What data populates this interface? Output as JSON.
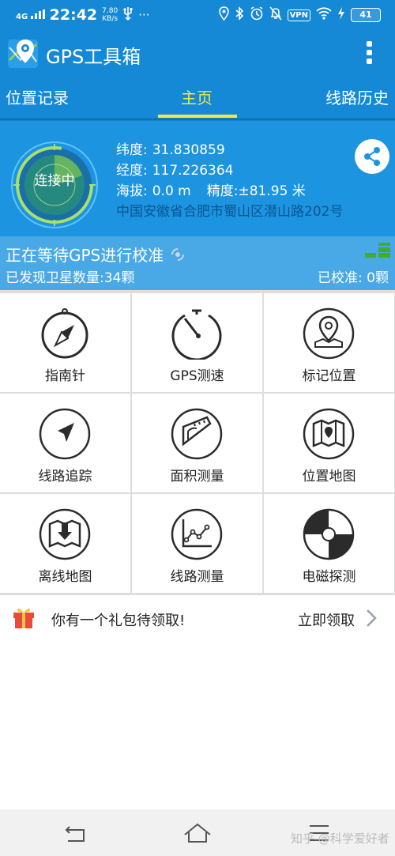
{
  "status_bar": {
    "network": "4G",
    "time": "22:42",
    "speed_value": "7.80",
    "speed_unit": "KB/s",
    "more": "···",
    "vpn": "VPN",
    "battery": "41"
  },
  "app": {
    "title": "GPS工具箱",
    "icons": [
      "gps-logo",
      "more-vertical-icon"
    ]
  },
  "tabs": [
    {
      "label": "位置记录",
      "active": false
    },
    {
      "label": "主页",
      "active": true
    },
    {
      "label": "线路历史",
      "active": false
    }
  ],
  "info": {
    "radar_label": "连接中",
    "latitude_label": "纬度:",
    "latitude": "31.830859",
    "longitude_label": "经度:",
    "longitude": "117.226364",
    "altitude_label": "海拔:",
    "altitude": "0.0 m",
    "accuracy_label": "精度:",
    "accuracy": "±81.95 米",
    "address": "中国安徽省合肥市蜀山区潜山路202号"
  },
  "calibration": {
    "title": "正在等待GPS进行校准",
    "satellites": "已发现卫星数量:34颗",
    "calibrated": "已校准: 0颗"
  },
  "tools": [
    {
      "label": "指南针",
      "icon": "compass-icon"
    },
    {
      "label": "GPS测速",
      "icon": "speedometer-icon"
    },
    {
      "label": "标记位置",
      "icon": "map-pin-icon"
    },
    {
      "label": "线路追踪",
      "icon": "navigation-arrow-icon"
    },
    {
      "label": "面积测量",
      "icon": "protractor-icon"
    },
    {
      "label": "位置地图",
      "icon": "folded-map-icon"
    },
    {
      "label": "离线地图",
      "icon": "offline-map-icon"
    },
    {
      "label": "线路测量",
      "icon": "line-chart-icon"
    },
    {
      "label": "电磁探测",
      "icon": "radar-disc-icon"
    }
  ],
  "gift": {
    "text": "你有一个礼包待领取!",
    "action": "立即领取"
  },
  "watermark": "知乎 @科学爱好者",
  "colors": {
    "primary": "#1689d6",
    "info_panel": "#1c94e0",
    "calibration": "#48a9e6",
    "active_tab": "#f5e64a",
    "address_text": "#0a5590"
  }
}
